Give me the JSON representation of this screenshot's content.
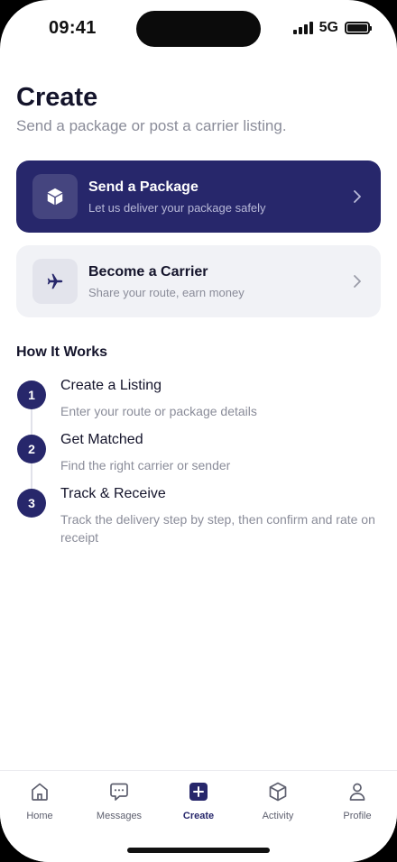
{
  "status_bar": {
    "time": "09:41",
    "network": "5G"
  },
  "header": {
    "title": "Create",
    "subtitle": "Send a package or post a carrier listing."
  },
  "actions": {
    "send": {
      "title": "Send a Package",
      "description": "Let us deliver your package safely",
      "icon": "box-icon"
    },
    "carrier": {
      "title": "Become a Carrier",
      "description": "Share your route, earn money",
      "icon": "airplane-icon"
    }
  },
  "how_it_works": {
    "title": "How It Works",
    "steps": [
      {
        "number": "1",
        "title": "Create a Listing",
        "description": "Enter your route or package details"
      },
      {
        "number": "2",
        "title": "Get Matched",
        "description": "Find the right carrier or sender"
      },
      {
        "number": "3",
        "title": "Track & Receive",
        "description": "Track the delivery step by step, then confirm and rate on receipt"
      }
    ]
  },
  "tabs": [
    {
      "label": "Home",
      "icon": "home-icon"
    },
    {
      "label": "Messages",
      "icon": "chat-icon"
    },
    {
      "label": "Create",
      "icon": "plus-icon",
      "active": true
    },
    {
      "label": "Activity",
      "icon": "cube-icon"
    },
    {
      "label": "Profile",
      "icon": "person-icon"
    }
  ],
  "colors": {
    "brand": "#27276b",
    "muted_text": "#8a8c99",
    "card_light": "#f1f2f6"
  }
}
